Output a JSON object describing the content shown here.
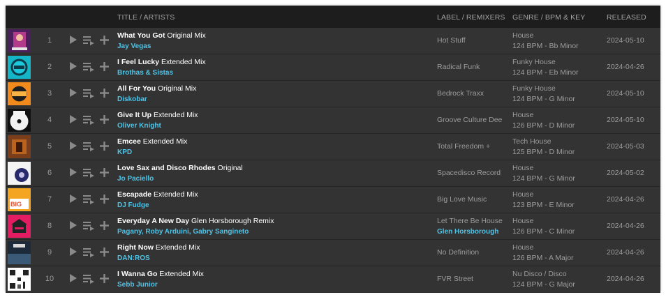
{
  "header": {
    "title": "TITLE / ARTISTS",
    "label": "LABEL / REMIXERS",
    "genre": "GENRE / BPM & KEY",
    "released": "RELEASED"
  },
  "tracks": [
    {
      "num": "1",
      "name": "What You Got",
      "mix": "Original Mix",
      "artists": "Jay Vegas",
      "label": "Hot Stuff",
      "remixers": "",
      "genre": "House",
      "bpm_key": "124 BPM - Bb Minor",
      "released": "2024-05-10"
    },
    {
      "num": "2",
      "name": "I Feel Lucky",
      "mix": "Extended Mix",
      "artists": "Brothas & Sistas",
      "label": "Radical Funk",
      "remixers": "",
      "genre": "Funky House",
      "bpm_key": "124 BPM - Eb Minor",
      "released": "2024-04-26"
    },
    {
      "num": "3",
      "name": "All For You",
      "mix": "Original Mix",
      "artists": "Diskobar",
      "label": "Bedrock Traxx",
      "remixers": "",
      "genre": "Funky House",
      "bpm_key": "124 BPM - G Minor",
      "released": "2024-05-10"
    },
    {
      "num": "4",
      "name": "Give It Up",
      "mix": "Extended Mix",
      "artists": "Oliver Knight",
      "label": "Groove Culture Dee",
      "remixers": "",
      "genre": "House",
      "bpm_key": "126 BPM - D Minor",
      "released": "2024-05-10"
    },
    {
      "num": "5",
      "name": "Emcee",
      "mix": "Extended Mix",
      "artists": "KPD",
      "label": "Total Freedom +",
      "remixers": "",
      "genre": "Tech House",
      "bpm_key": "125 BPM - D Minor",
      "released": "2024-05-03"
    },
    {
      "num": "6",
      "name": "Love Sax and Disco Rhodes",
      "mix": "Original",
      "artists": "Jo Paciello",
      "label": "Spacedisco Record",
      "remixers": "",
      "genre": "House",
      "bpm_key": "124 BPM - G Minor",
      "released": "2024-05-02"
    },
    {
      "num": "7",
      "name": "Escapade",
      "mix": "Extended Mix",
      "artists": "DJ Fudge",
      "label": "Big Love Music",
      "remixers": "",
      "genre": "House",
      "bpm_key": "123 BPM - E Minor",
      "released": "2024-04-26"
    },
    {
      "num": "8",
      "name": "Everyday A New Day",
      "mix": "Glen Horsborough Remix",
      "artists": "Pagany, Roby Arduini, Gabry Sangineto",
      "label": "Let There Be House",
      "remixers": "Glen Horsborough",
      "genre": "House",
      "bpm_key": "126 BPM - C Minor",
      "released": "2024-04-26"
    },
    {
      "num": "9",
      "name": "Right Now",
      "mix": "Extended Mix",
      "artists": "DAN:ROS",
      "label": "No Definition",
      "remixers": "",
      "genre": "House",
      "bpm_key": "126 BPM - A Major",
      "released": "2024-04-26"
    },
    {
      "num": "10",
      "name": "I Wanna Go",
      "mix": "Extended Mix",
      "artists": "Sebb Junior",
      "label": "FVR Street",
      "remixers": "",
      "genre": "Nu Disco / Disco",
      "bpm_key": "124 BPM - G Major",
      "released": "2024-04-26"
    }
  ],
  "row_icons": {
    "play": "play-icon",
    "queue": "add-to-queue-icon",
    "add": "plus-icon"
  },
  "colors": {
    "artist_link": "#4fc3e6",
    "row_bg": "#333333",
    "header_bg": "#1d1d1d"
  }
}
